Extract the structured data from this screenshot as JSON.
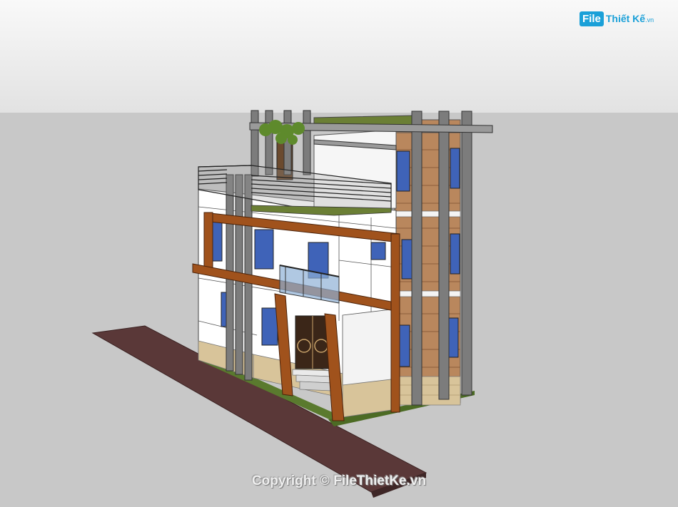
{
  "watermark": {
    "logo_badge": "File",
    "logo_text": "Thiết Kế",
    "logo_suffix": ".vn",
    "copyright": "Copyright © FileThietKe.vn"
  },
  "colors": {
    "sky": "#f0f0f0",
    "ground": "#c8c8c8",
    "path": "#5a3838",
    "wall": "#ffffff",
    "wood_frame": "#a0521c",
    "column": "#7c7c7c",
    "glass": "#3f63b8",
    "wood_cladding": "#b9875d",
    "stone": "#d8c49a",
    "grass": "#5a7a2e",
    "logo": "#1aa0d8"
  }
}
